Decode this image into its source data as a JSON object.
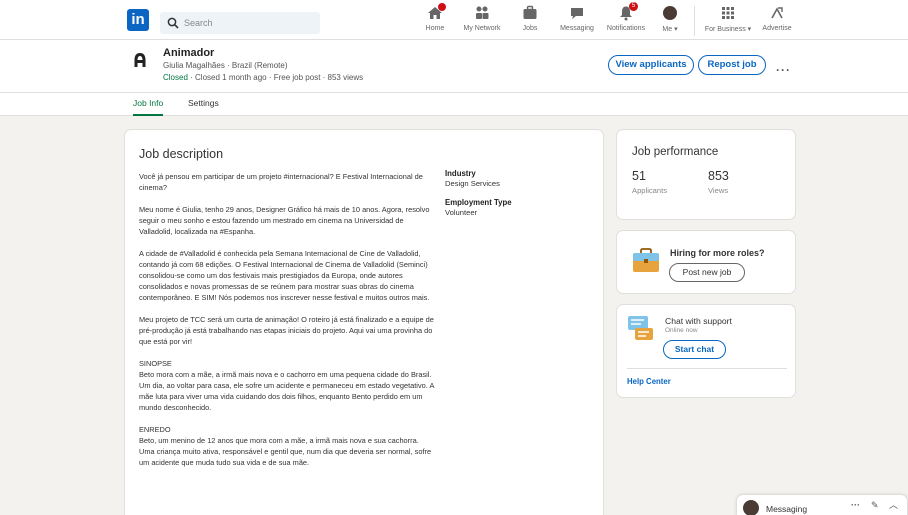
{
  "nav": {
    "logo_text": "in",
    "search_placeholder": "Search",
    "items": [
      {
        "label": "Home",
        "icon": "home-icon",
        "badge": ""
      },
      {
        "label": "My Network",
        "icon": "network-icon",
        "badge": ""
      },
      {
        "label": "Jobs",
        "icon": "briefcase-icon",
        "badge": ""
      },
      {
        "label": "Messaging",
        "icon": "message-icon",
        "badge": ""
      },
      {
        "label": "Notifications",
        "icon": "bell-icon",
        "badge": "5"
      },
      {
        "label": "Me ▾",
        "icon": "avatar",
        "badge": ""
      },
      {
        "label": "For Business ▾",
        "icon": "grid-icon",
        "badge": ""
      },
      {
        "label": "Advertise",
        "icon": "advertise-icon",
        "badge": ""
      }
    ]
  },
  "job": {
    "title": "Animador",
    "subtitle": "Giulia Magalhães · Brazil (Remote)",
    "status": "Closed",
    "status_rest": " · Closed 1 month ago · Free job post · 853 views",
    "view_applicants": "View applicants",
    "repost": "Repost job",
    "more": "···"
  },
  "tabs": {
    "job_info": "Job Info",
    "settings": "Settings"
  },
  "description": {
    "title": "Job description",
    "paragraphs": [
      "Você já pensou em participar de um projeto #internacional? E Festival Internacional de cinema?",
      "Meu nome é Giulia, tenho 29 anos, Designer Gráfico há mais de 10 anos. Agora, resolvo seguir o meu sonho e estou fazendo um mestrado em cinema na Universidad de Valladolid, localizada na #Espanha.",
      "A cidade de #Valladolid é conhecida pela Semana Internacional de Cine de Valladolid, contando já com 68 edições. O Festival Internacional de Cinema de Valladolid (Seminci) consolidou-se como um dos festivais mais prestigiados da Europa, onde autores consolidados e novas promessas de se reúnem para mostrar suas obras do cinema contemporâneo. E SIM! Nós podemos nos inscrever nesse festival e muitos outros mais.",
      "Meu projeto de TCC será um curta de animação! O roteiro já está finalizado e a equipe de pré-produção já está trabalhando nas etapas iniciais do projeto. Aqui vai uma provinha do que está por vir!",
      "SINOPSE\nBeto mora com a mãe, a irmã mais nova e o cachorro em uma pequena cidade do Brasil. Um dia, ao voltar para casa, ele sofre um acidente e permaneceu em estado vegetativo. A mãe luta para viver uma vida cuidando dos dois filhos, enquanto Bento perdido em um mundo desconhecido.",
      "ENREDO\nBeto, um menino de 12 anos que mora com a mãe, a irmã mais nova e sua cachorra. Uma criança muito ativa, responsável e gentil que, num dia que deveria ser normal, sofre um acidente que muda tudo sua vida e de sua mãe."
    ],
    "industry_label": "Industry",
    "industry_value": "Design Services",
    "employment_label": "Employment Type",
    "employment_value": "Volunteer"
  },
  "performance": {
    "title": "Job performance",
    "applicants_count": "51",
    "applicants_label": "Applicants",
    "views_count": "853",
    "views_label": "Views"
  },
  "hiring": {
    "title": "Hiring for more roles?",
    "button": "Post new job"
  },
  "support": {
    "title": "Chat with support",
    "status": "Online now",
    "button": "Start chat",
    "help": "Help Center"
  },
  "messaging": {
    "label": "Messaging",
    "dots": "···",
    "compose": "✎",
    "collapse": "︿"
  },
  "colors": {
    "brand": "#0a66c2",
    "green": "#057642",
    "badge": "#cc1016"
  }
}
